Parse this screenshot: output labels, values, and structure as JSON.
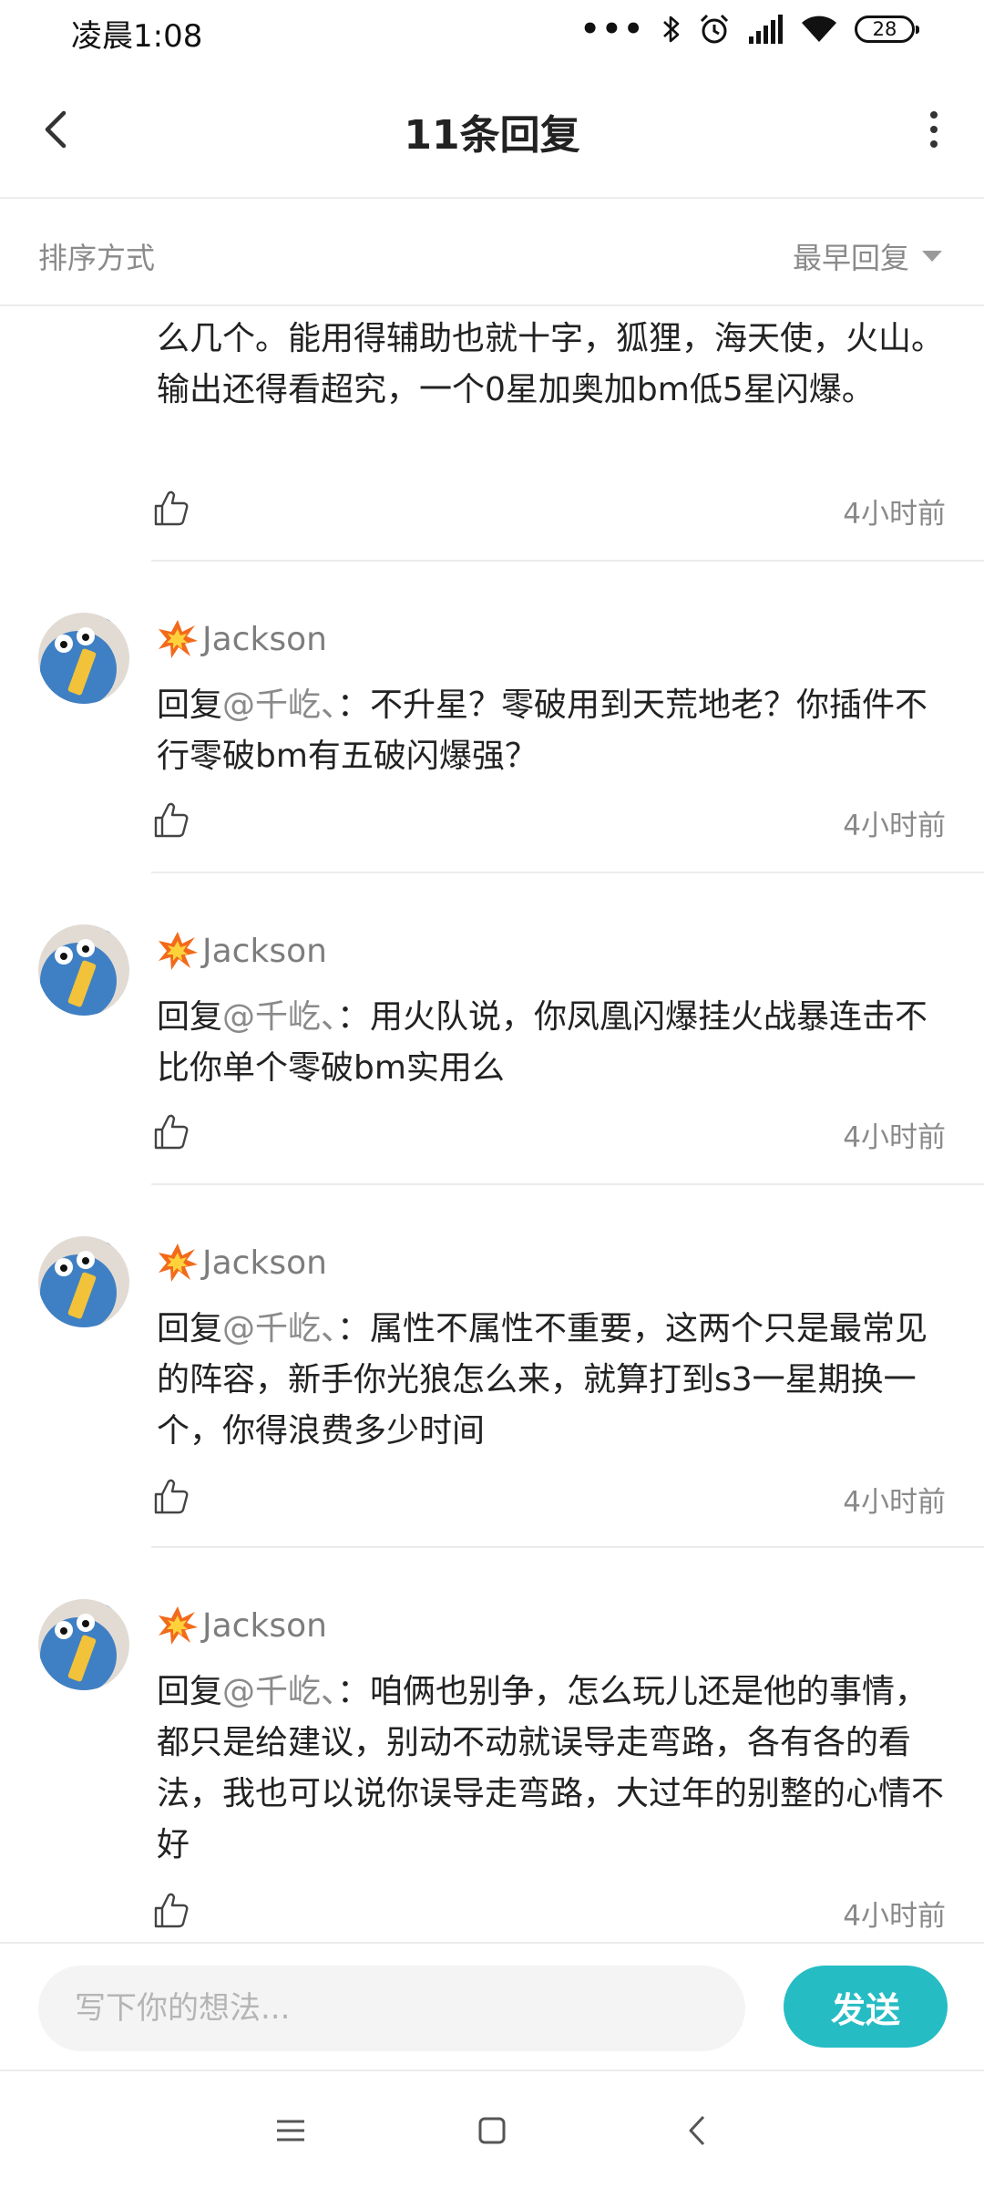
{
  "status_bar": {
    "time": "凌晨1:08",
    "dots": "•••",
    "battery": "28"
  },
  "header": {
    "title": "11条回复"
  },
  "sort": {
    "label": "排序方式",
    "value": "最早回复"
  },
  "partial_reply": {
    "text": "么几个。能用得辅助也就十字，狐狸，海天使，火山。 输出还得看超究，一个0星加奥加bm低5星闪爆。",
    "time": "4小时前"
  },
  "replies": [
    {
      "username": "Jackson",
      "prefix": "回复",
      "mention": "@千屹、",
      "colon": "：",
      "text": "不升星？零破用到天荒地老？你插件不行零破bm有五破闪爆强？",
      "time": "4小时前"
    },
    {
      "username": "Jackson",
      "prefix": "回复",
      "mention": "@千屹、",
      "colon": "：",
      "text": "用火队说，你凤凰闪爆挂火战暴连击不比你单个零破bm实用么",
      "time": "4小时前"
    },
    {
      "username": "Jackson",
      "prefix": "回复",
      "mention": "@千屹、",
      "colon": "：",
      "text": "属性不属性不重要，这两个只是最常见的阵容，新手你光狼怎么来，就算打到s3一星期换一个，你得浪费多少时间",
      "time": "4小时前"
    },
    {
      "username": "Jackson",
      "prefix": "回复",
      "mention": "@千屹、",
      "colon": "：",
      "text": "咱俩也别争，怎么玩儿还是他的事情，都只是给建议，别动不动就误导走弯路，各有各的看法，我也可以说你误导走弯路，大过年的别整的心情不好",
      "time": "4小时前"
    }
  ],
  "composer": {
    "placeholder": "写下你的想法...",
    "send_label": "发送"
  },
  "colors": {
    "accent": "#26bcc4",
    "secondary_text": "#8a8a8a",
    "divider": "#ececec"
  },
  "icons": [
    "back-arrow-icon",
    "more-vertical-icon",
    "dropdown-triangle-icon",
    "thumbs-up-icon",
    "explosion-badge-icon",
    "menu-icon",
    "home-square-icon",
    "nav-back-icon",
    "bluetooth-icon",
    "alarm-icon",
    "signal-icon",
    "wifi-icon"
  ]
}
